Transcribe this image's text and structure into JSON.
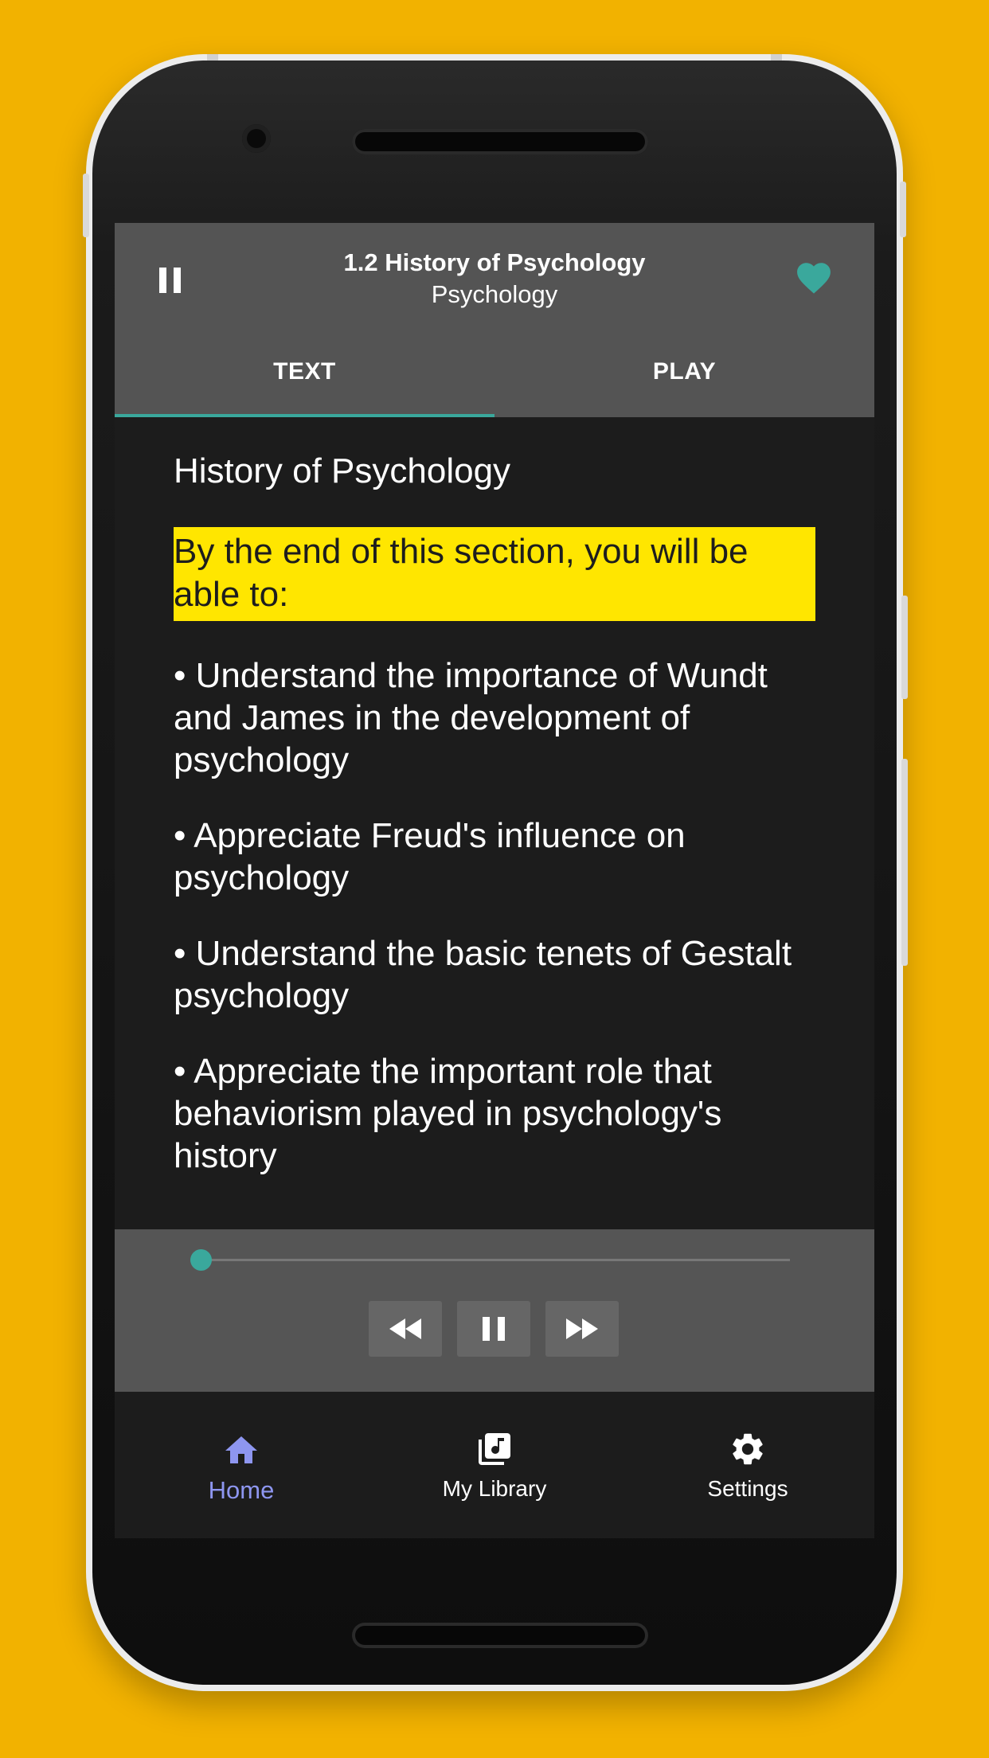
{
  "header": {
    "title": "1.2 History of Psychology",
    "subtitle": "Psychology",
    "pause_icon": "pause-icon",
    "favorite_icon": "heart-icon"
  },
  "tabs": [
    {
      "label": "TEXT",
      "active": true
    },
    {
      "label": "PLAY",
      "active": false
    }
  ],
  "content": {
    "heading": "History of Psychology",
    "highlight": "By the end of this section, you will be able to:",
    "bullets": [
      " • Understand the importance of Wundt and James in the development of psychology",
      " • Appreciate Freud's influence on psychology",
      " • Understand the basic tenets of Gestalt psychology",
      " • Appreciate the important role that behaviorism played in psychology's history"
    ]
  },
  "player": {
    "progress": 0.0,
    "controls": [
      "rewind-icon",
      "pause-icon",
      "fast-forward-icon"
    ]
  },
  "bottom_nav": [
    {
      "label": "Home",
      "icon": "home-icon",
      "active": true
    },
    {
      "label": "My Library",
      "icon": "library-music-icon",
      "active": false
    },
    {
      "label": "Settings",
      "icon": "gear-icon",
      "active": false
    }
  ],
  "colors": {
    "background": "#F2B200",
    "accent": "#3AA89C",
    "highlight": "#FFE600",
    "nav_active": "#8E96F0",
    "header": "#545454",
    "screen": "#1C1C1C"
  }
}
